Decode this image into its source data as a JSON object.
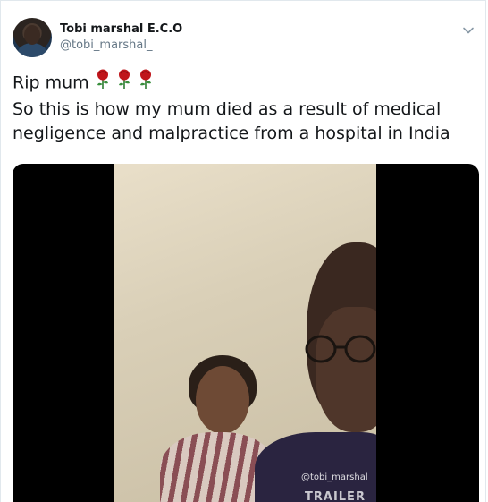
{
  "tweet": {
    "author": {
      "display_name": "Tobi marshal E.C.O",
      "handle": "@tobi_marshal_"
    },
    "text_line1": "Rip mum",
    "text_line2": "So this is how my mum died as a result of medical",
    "text_line3": "negligence and malpractice from a hospital in India",
    "rose_count": 3,
    "menu_icon": "chevron-down-icon"
  },
  "media": {
    "watermark": "@tobi_marshal",
    "overlay_logo": "TRAILER"
  },
  "colors": {
    "text": "#14171a",
    "secondary": "#657786",
    "rose": "#c0151b"
  }
}
